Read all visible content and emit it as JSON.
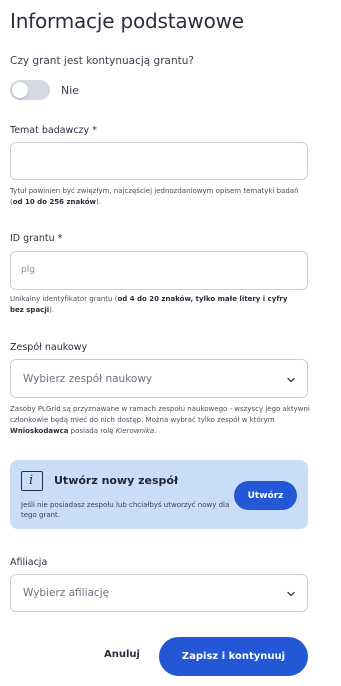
{
  "page": {
    "title": "Informacje podstawowe"
  },
  "continuation": {
    "question": "Czy grant jest kontynuacją grantu?",
    "toggle_label": "Nie",
    "toggle_on": false
  },
  "research_topic": {
    "label": "Temat badawczy *",
    "value": "",
    "help_prefix": "Tytuł powinien być zwięzłym, najczęściej jednozdaniowym opisem tematyki badań (",
    "help_bold": "od 10 do 256 znaków",
    "help_suffix": ")."
  },
  "grant_id": {
    "label": "ID grantu *",
    "placeholder": "plg",
    "help_prefix": "Unikalny identyfikator grantu (",
    "help_bold": "od 4 do 20 znaków, tylko małe litery i cyfry bez spacji",
    "help_suffix": ")."
  },
  "team": {
    "label": "Zespół naukowy",
    "placeholder": "Wybierz zespół naukowy",
    "help_part1": "Zasoby PLGrid są przyznawane w ramach zespołu naukowego - wszyscy jego aktywni członkowie będą mieć do nich dostęp. Można wybrać tylko zespół w którym ",
    "help_bold": "Wnioskodawca",
    "help_part2": " posiada rolę ",
    "help_italic": "Kierownika",
    "help_end": "."
  },
  "new_team_box": {
    "icon": "info-icon",
    "title": "Utwórz nowy zespół",
    "text": "Jeśli nie posiadasz zespołu lub chciałbyś utworzyć nowy dla tego grant.",
    "button_label": "Utwórz"
  },
  "affiliation": {
    "label": "Afiliacja",
    "placeholder": "Wybierz afiliację"
  },
  "actions": {
    "cancel_label": "Anuluj",
    "save_label": "Zapisz i kontynuuj"
  },
  "colors": {
    "primary": "#2357d6",
    "info_bg": "#c9ddf8",
    "toggle_off": "#d5d9e3",
    "border": "#c9ced9"
  }
}
